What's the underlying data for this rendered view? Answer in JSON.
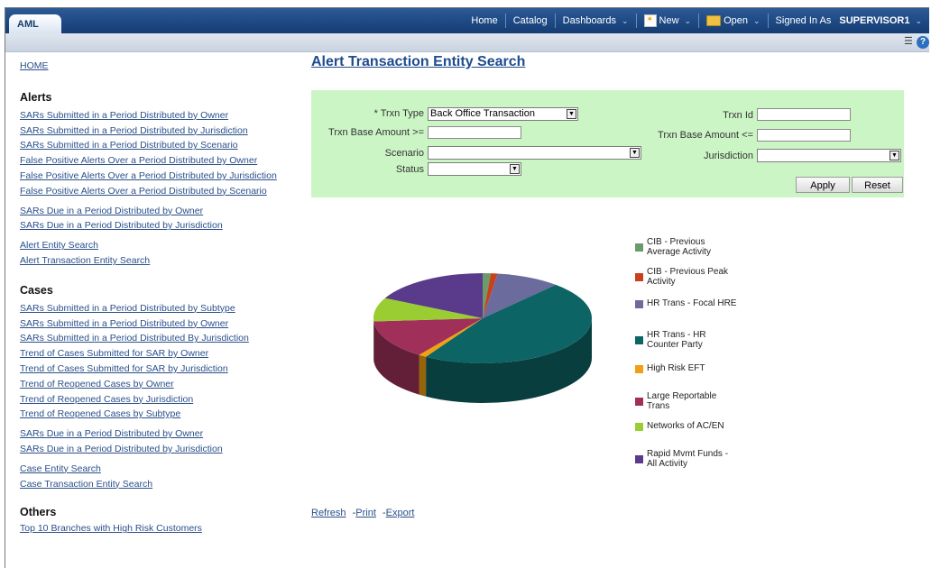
{
  "app": {
    "tab": "AML"
  },
  "nav": {
    "home": "Home",
    "catalog": "Catalog",
    "dashboards": "Dashboards",
    "new": "New",
    "open": "Open",
    "signed_in_prefix": "Signed In As",
    "user": "SUPERVISOR1"
  },
  "sidebar": {
    "home": "HOME",
    "alerts": {
      "heading": "Alerts",
      "group1": [
        "SARs Submitted in a Period Distributed by Owner",
        "SARs Submitted in a Period Distributed by Jurisdiction",
        "SARs Submitted in a Period Distributed by Scenario",
        "False Positive Alerts Over a Period Distributed by Owner",
        "False Positive Alerts Over a Period Distributed by Jurisdiction",
        "False Positive Alerts Over a Period Distributed by Scenario"
      ],
      "group2": [
        "SARs Due in a Period Distributed by Owner",
        "SARs Due in a Period Distributed by Jurisdiction"
      ],
      "group3": [
        "Alert Entity Search",
        "Alert Transaction Entity Search"
      ]
    },
    "cases": {
      "heading": "Cases",
      "group1": [
        "SARs Submitted in a Period Distributed by Subtype",
        "SARs Submitted in a Period Distributed by Owner",
        "SARs Submitted in a Period Distributed By Jurisdiction",
        "Trend of Cases Submitted for SAR by Owner",
        "Trend of Cases Submitted for SAR by Jurisdiction",
        "Trend of Reopened Cases by Owner",
        "Trend of Reopened Cases by Jurisdiction",
        "Trend of Reopened Cases by Subtype"
      ],
      "group2": [
        "SARs Due in a Period Distributed by Owner",
        "SARs Due in a Period Distributed by Jurisdiction"
      ],
      "group3": [
        "Case Entity Search",
        "Case Transaction Entity Search"
      ]
    },
    "others": {
      "heading": "Others",
      "group1": [
        "Top 10 Branches with High Risk Customers"
      ]
    }
  },
  "main": {
    "title": "Alert Transaction Entity Search"
  },
  "filters": {
    "trxn_type_label": "* Trxn Type",
    "trxn_type_value": "Back Office Transaction",
    "trxn_base_gte_label": "Trxn Base Amount >=",
    "trxn_base_gte_value": "",
    "scenario_label": "Scenario",
    "scenario_value": "",
    "status_label": "Status",
    "status_value": "",
    "trxn_id_label": "Trxn Id",
    "trxn_id_value": "",
    "trxn_base_lte_label": "Trxn Base Amount <=",
    "trxn_base_lte_value": "",
    "jurisdiction_label": "Jurisdiction",
    "jurisdiction_value": "",
    "apply": "Apply",
    "reset": "Reset"
  },
  "chart_data": {
    "type": "pie",
    "title": "",
    "series": [
      {
        "name": "CIB - Previous Average Activity",
        "value": 1.2,
        "color": "#6b9a6b"
      },
      {
        "name": "CIB - Previous Peak Activity",
        "value": 1.0,
        "color": "#c8401c"
      },
      {
        "name": "HR Trans - Focal HRE",
        "value": 9.5,
        "color": "#6b6b9e"
      },
      {
        "name": "HR Trans - HR Counter Party",
        "value": 47.0,
        "color": "#0d6464"
      },
      {
        "name": "High Risk EFT",
        "value": 1.2,
        "color": "#f0a010"
      },
      {
        "name": "Large Reportable Trans",
        "value": 14.0,
        "color": "#a0305a"
      },
      {
        "name": "Networks of AC/EN",
        "value": 8.5,
        "color": "#9acd32"
      },
      {
        "name": "Rapid Mvmt Funds - All Activity",
        "value": 17.6,
        "color": "#5a3a8a"
      }
    ],
    "legend_position": "right"
  },
  "actions": {
    "refresh": "Refresh",
    "print": "Print",
    "export": "Export",
    "sep": "-"
  }
}
